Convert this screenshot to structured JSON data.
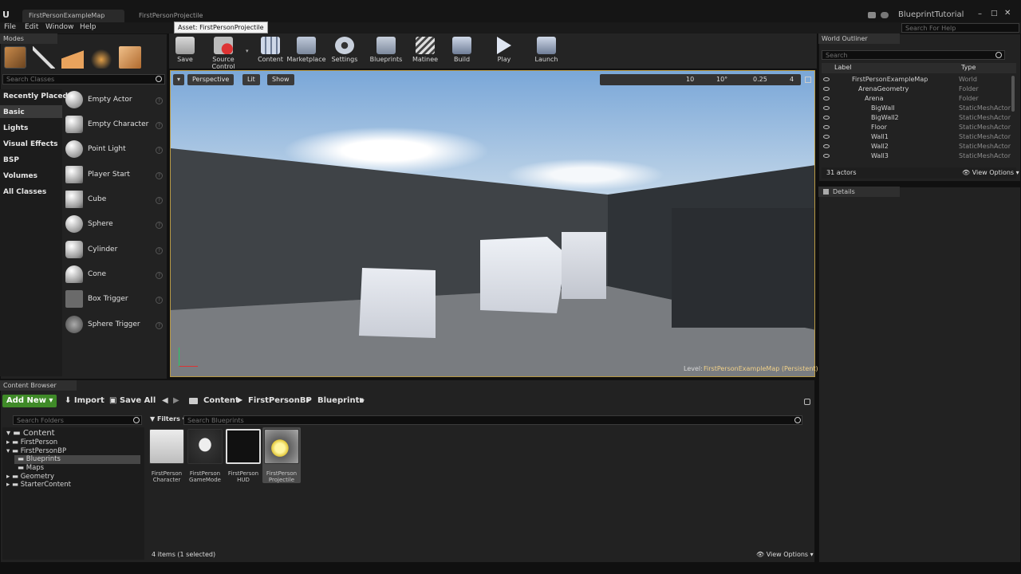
{
  "window": {
    "tabs": [
      {
        "label": "FirstPersonExampleMap",
        "active": true
      },
      {
        "label": "FirstPersonProjectile",
        "active": false
      }
    ],
    "tooltip": "Asset: FirstPersonProjectile",
    "project_name": "BlueprintTutorial",
    "help_search_placeholder": "Search For Help"
  },
  "menu": {
    "items": [
      "File",
      "Edit",
      "Window",
      "Help"
    ]
  },
  "modes": {
    "title": "Modes",
    "search_placeholder": "Search Classes",
    "categories": [
      "Recently Placed",
      "Basic",
      "Lights",
      "Visual Effects",
      "BSP",
      "Volumes",
      "All Classes"
    ],
    "items": [
      "Empty Actor",
      "Empty Character",
      "Point Light",
      "Player Start",
      "Cube",
      "Sphere",
      "Cylinder",
      "Cone",
      "Box Trigger",
      "Sphere Trigger"
    ]
  },
  "toolbar": {
    "buttons": [
      "Save",
      "Source Control",
      "Content",
      "Marketplace",
      "Settings",
      "Blueprints",
      "Matinee",
      "Build",
      "Play",
      "Launch"
    ]
  },
  "viewport": {
    "perspective": "Perspective",
    "lit": "Lit",
    "show": "Show",
    "grid_value": "10",
    "rot_value": "10°",
    "scale_value": "0.25",
    "cam_speed": "4",
    "level_label": "Level:",
    "level_name": "FirstPersonExampleMap (Persistent)"
  },
  "outliner": {
    "title": "World Outliner",
    "search_placeholder": "Search",
    "col_label": "Label",
    "col_type": "Type",
    "rows": [
      {
        "label": "FirstPersonExampleMap",
        "type": "World"
      },
      {
        "label": "ArenaGeometry",
        "type": "Folder"
      },
      {
        "label": "Arena",
        "type": "Folder"
      },
      {
        "label": "BigWall",
        "type": "StaticMeshActor"
      },
      {
        "label": "BigWall2",
        "type": "StaticMeshActor"
      },
      {
        "label": "Floor",
        "type": "StaticMeshActor"
      },
      {
        "label": "Wall1",
        "type": "StaticMeshActor"
      },
      {
        "label": "Wall2",
        "type": "StaticMeshActor"
      },
      {
        "label": "Wall3",
        "type": "StaticMeshActor"
      }
    ],
    "actor_count": "31 actors",
    "view_options": "View Options"
  },
  "details": {
    "title": "Details"
  },
  "content_browser": {
    "title": "Content Browser",
    "add_new": "Add New",
    "import": "Import",
    "save_all": "Save All",
    "breadcrumb": [
      "Content",
      "FirstPersonBP",
      "Blueprints"
    ],
    "search_folders_placeholder": "Search Folders",
    "filters": "Filters",
    "search_assets_placeholder": "Search Blueprints",
    "folders": [
      {
        "label": "Content",
        "depth": 0
      },
      {
        "label": "FirstPerson",
        "depth": 1
      },
      {
        "label": "FirstPersonBP",
        "depth": 1
      },
      {
        "label": "Blueprints",
        "depth": 2
      },
      {
        "label": "Maps",
        "depth": 2
      },
      {
        "label": "Geometry",
        "depth": 1
      },
      {
        "label": "StarterContent",
        "depth": 1
      }
    ],
    "assets": [
      {
        "line1": "FirstPerson",
        "line2": "Character"
      },
      {
        "line1": "FirstPerson",
        "line2": "GameMode"
      },
      {
        "line1": "FirstPerson",
        "line2": "HUD"
      },
      {
        "line1": "FirstPerson",
        "line2": "Projectile"
      }
    ],
    "status": "4 items (1 selected)",
    "view_options": "View Options"
  }
}
